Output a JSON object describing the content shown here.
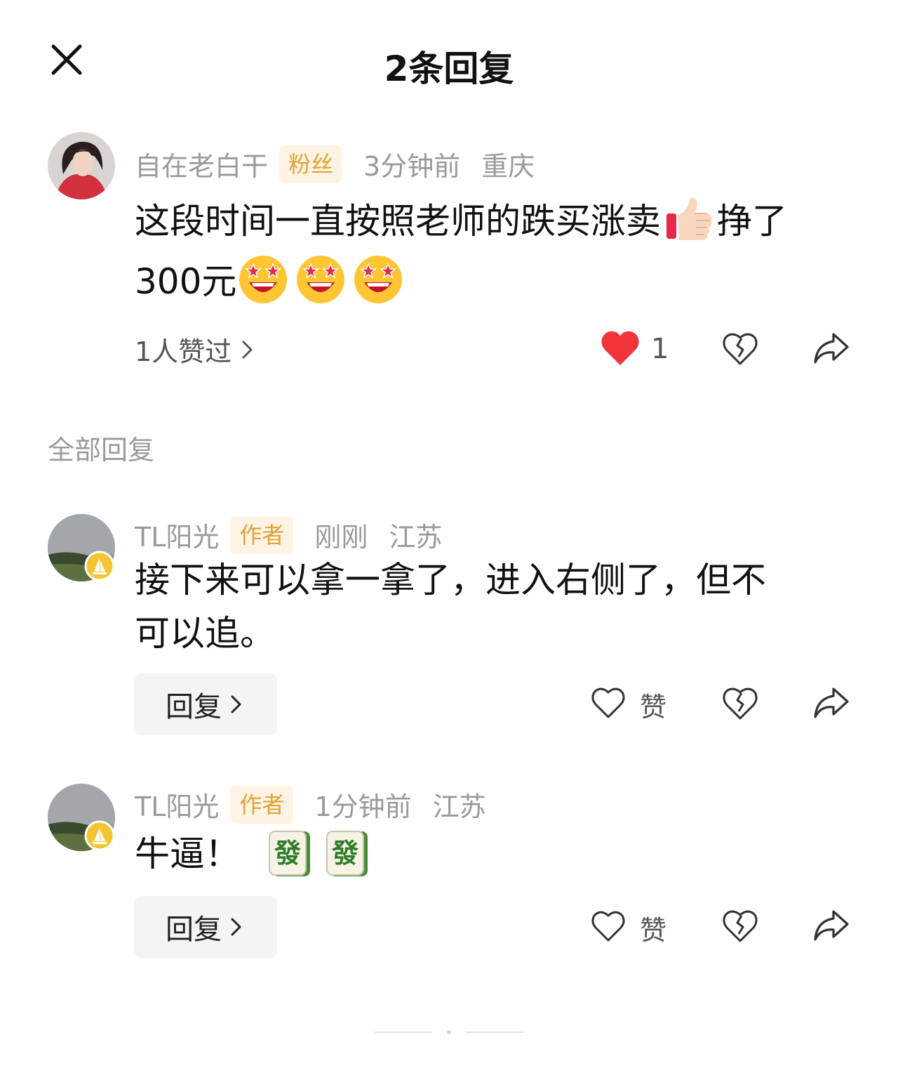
{
  "header": {
    "title": "2条回复",
    "close_icon": "close-icon"
  },
  "main_comment": {
    "username": "自在老白干",
    "badge": "粉丝",
    "time": "3分钟前",
    "location": "重庆",
    "text_line1": "这段时间一直按照老师的跌买涨卖",
    "text_line1_end": "挣了",
    "text_line2": "300元",
    "likes_summary": "1人赞过",
    "like_count": "1",
    "like_color": "#f1353a"
  },
  "replies_section_label": "全部回复",
  "replies": [
    {
      "username": "TL阳光",
      "badge": "作者",
      "time": "刚刚",
      "location": "江苏",
      "text_line1": "接下来可以拿一拿了，进入右侧了，但不",
      "text_line2": "可以追。",
      "reply_button": "回复",
      "like_label": "赞"
    },
    {
      "username": "TL阳光",
      "badge": "作者",
      "time": "1分钟前",
      "location": "江苏",
      "text_line1": "牛逼！",
      "tile_char": "發",
      "reply_button": "回复",
      "like_label": "赞"
    }
  ]
}
